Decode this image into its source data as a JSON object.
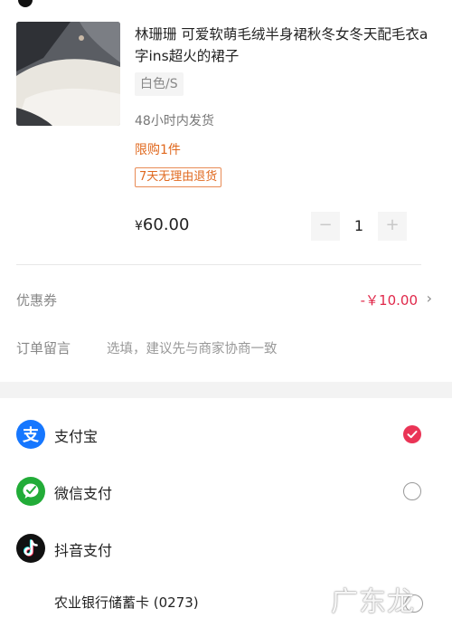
{
  "product": {
    "title": "林珊珊 可爱软萌毛绒半身裙秋冬女冬天配毛衣a字ins超火的裙子",
    "spec": "白色/S",
    "shipping": "48小时内发货",
    "limit": "限购1件",
    "return_tag": "7天无理由退货",
    "price_symbol": "¥",
    "price_value": "60.00",
    "quantity": "1",
    "minus": "−",
    "plus": "+"
  },
  "coupon": {
    "label": "优惠券",
    "value": "-￥10.00",
    "chevron": "›"
  },
  "note": {
    "label": "订单留言",
    "placeholder": "选填，建议先与商家协商一致"
  },
  "payment": {
    "methods": [
      {
        "label": "支付宝",
        "icon": "alipay-icon",
        "color": "#1677ff",
        "selected": true
      },
      {
        "label": "微信支付",
        "icon": "wechat-pay-icon",
        "color": "#22ac38",
        "selected": false
      },
      {
        "label": "抖音支付",
        "icon": "douyin-pay-icon",
        "color": "#111111",
        "selected": false
      }
    ],
    "bank_card": "农业银行储蓄卡 (0273)"
  },
  "watermark": "广东龙网",
  "colors": {
    "accent": "#ea3456",
    "orange": "#e0691f"
  }
}
